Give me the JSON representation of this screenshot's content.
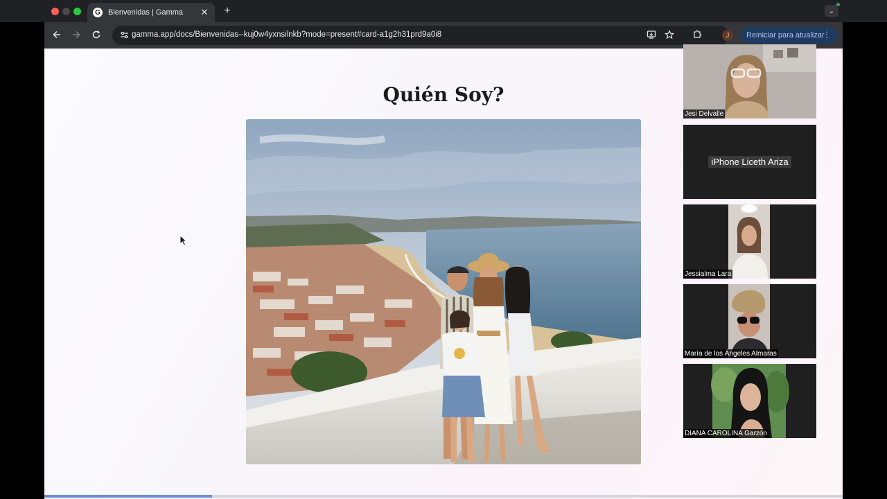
{
  "browser": {
    "tab_title": "Bienvenidas | Gamma",
    "tab_favicon": "G",
    "url": "gamma.app/docs/Bienvenidas--kuj0w4yxnsilnkb?mode=present#card-a1g2h31prd9a0i8",
    "profile_initial": "J",
    "update_label": "Reiniciar para atualizar"
  },
  "slide": {
    "title": "Quién Soy?"
  },
  "progress": {
    "fraction": 0.21
  },
  "participants": [
    {
      "name": "Jesi Delvalle",
      "video": true
    },
    {
      "name": "iPhone Liceth Ariza",
      "video": false
    },
    {
      "name": "Jessialma Lara",
      "video": true
    },
    {
      "name": "María de los Ángeles Almaras",
      "video": true
    },
    {
      "name": "DIANA CAROLINA Garzón",
      "video": true
    }
  ],
  "icons": {
    "back": "arrow-left-icon",
    "forward": "arrow-right-icon",
    "reload": "reload-icon",
    "site_info": "tune-icon",
    "cast": "install-icon",
    "star": "star-icon",
    "extensions": "puzzle-icon",
    "menu": "kebab-menu-icon"
  },
  "colors": {
    "progress_fill": "#6a8fd6",
    "update_button": "#1f3a5f"
  }
}
